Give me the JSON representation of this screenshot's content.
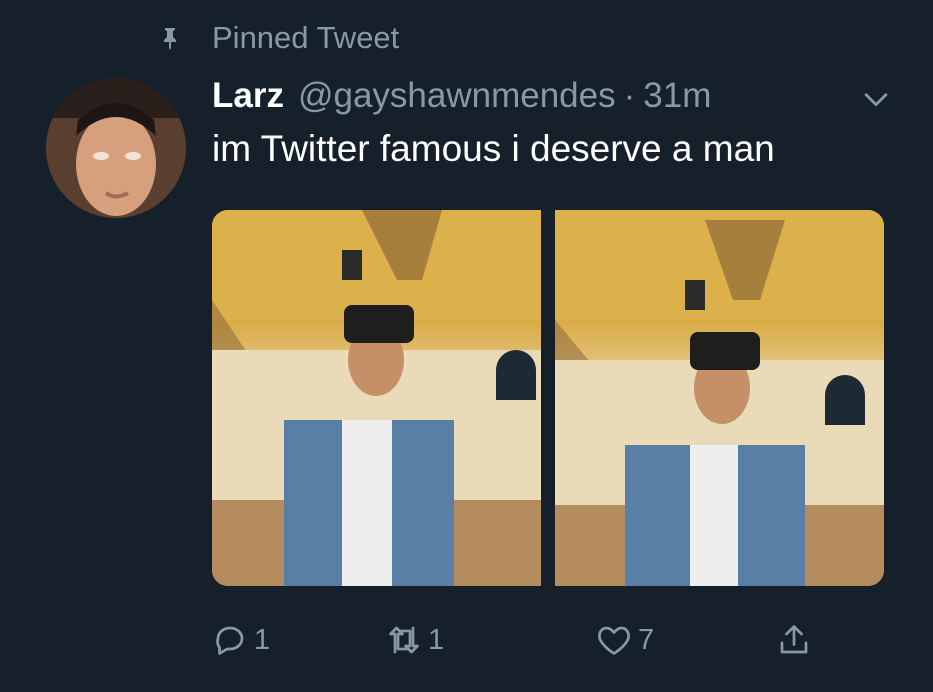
{
  "pinned": {
    "label": "Pinned Tweet"
  },
  "tweet": {
    "display_name": "Larz",
    "handle": "@gayshawnmendes",
    "separator": "·",
    "time": "31m",
    "text": "im Twitter famous i deserve a man"
  },
  "actions": {
    "reply_count": "1",
    "retweet_count": "1",
    "like_count": "7"
  },
  "icons": {
    "pin": "pin-icon",
    "caret": "chevron-down-icon",
    "reply": "reply-icon",
    "retweet": "retweet-icon",
    "like": "heart-icon",
    "share": "share-icon"
  },
  "colors": {
    "background": "#15202b",
    "text_primary": "#ffffff",
    "text_secondary": "#8899a6"
  }
}
